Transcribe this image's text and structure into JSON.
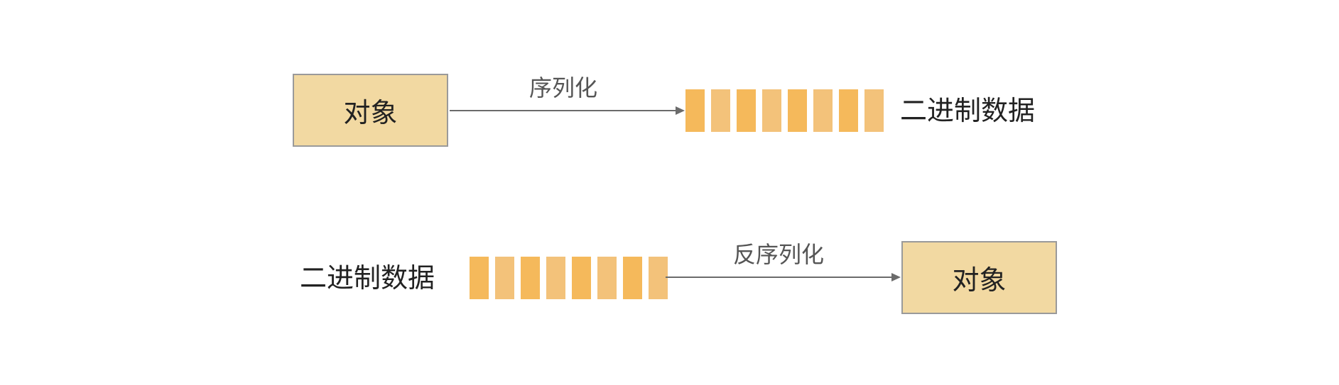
{
  "row1": {
    "object_label": "对象",
    "operation_label": "序列化",
    "binary_label": "二进制数据"
  },
  "row2": {
    "binary_label": "二进制数据",
    "operation_label": "反序列化",
    "object_label": "对象"
  },
  "colors": {
    "object_fill": "#f2d9a2",
    "object_border": "#9a9a9a",
    "bit_dark": "#f5b95b",
    "bit_light": "#f3c27a",
    "arrow": "#6b6b6b"
  }
}
